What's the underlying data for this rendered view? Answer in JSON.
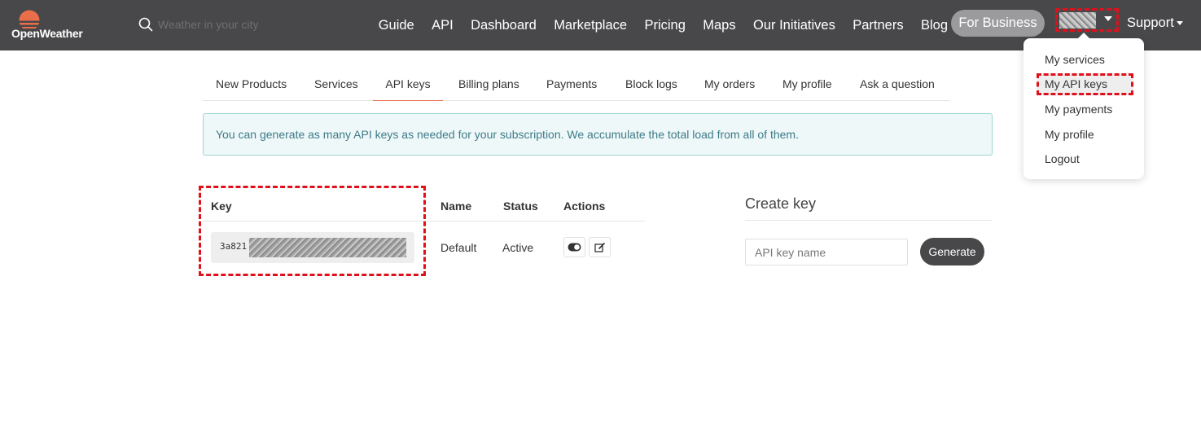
{
  "brand": {
    "logo_text": "OpenWeather",
    "accent": "#eb6e4b"
  },
  "search": {
    "placeholder": "Weather in your city",
    "value": ""
  },
  "nav": {
    "items": [
      "Guide",
      "API",
      "Dashboard",
      "Marketplace",
      "Pricing",
      "Maps",
      "Our Initiatives",
      "Partners",
      "Blog"
    ],
    "business_label": "For Business",
    "support_label": "Support"
  },
  "user_menu": {
    "items": [
      "My services",
      "My API keys",
      "My payments",
      "My profile",
      "Logout"
    ],
    "highlighted": "My API keys"
  },
  "tabs": {
    "items": [
      "New Products",
      "Services",
      "API keys",
      "Billing plans",
      "Payments",
      "Block logs",
      "My orders",
      "My profile",
      "Ask a question"
    ],
    "active": "API keys"
  },
  "info_message": "You can generate as many API keys as needed for your subscription. We accumulate the total load from all of them.",
  "keys_table": {
    "headers": {
      "key": "Key",
      "name": "Name",
      "status": "Status",
      "actions": "Actions"
    },
    "rows": [
      {
        "key_visible": "3a821",
        "name": "Default",
        "status": "Active"
      }
    ],
    "action_icons": [
      "toggle-icon",
      "edit-icon"
    ]
  },
  "create_key": {
    "title": "Create key",
    "input_placeholder": "API key name",
    "input_value": "",
    "button_label": "Generate"
  },
  "colors": {
    "navbar_bg": "#48484a",
    "annotation": "#e0101a",
    "info_bg": "#eef8f8",
    "info_text": "#3f7b89",
    "tab_active_underline": "#e96e50"
  }
}
